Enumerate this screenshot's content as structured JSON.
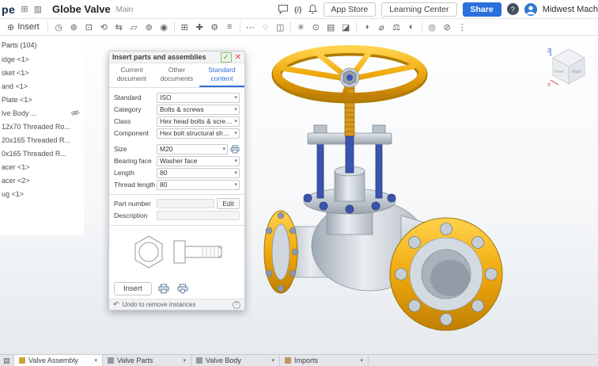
{
  "ui": {
    "caret_glyph": "▾",
    "check_glyph": "✓",
    "close_glyph": "✕",
    "undo_glyph": "↶",
    "help_glyph": "?",
    "insert_plus_glyph": "⊕",
    "grid_glyph": "⊞",
    "panel_glyph": "▥",
    "code_glyph": "{/}",
    "tab_manager_glyph": "▤"
  },
  "colors": {
    "accent_blue": "#2e6fd6",
    "share_blue": "#2a6fdb",
    "valve_gold": "#e8a80c",
    "valve_blue": "#3b55ae"
  },
  "header": {
    "logo_fragment": "pe",
    "title": "Globe Valve",
    "subtitle": "Main",
    "app_store": "App Store",
    "learning_center": "Learning Center",
    "share": "Share",
    "user_name": "Midwest Mach"
  },
  "toolbar": {
    "insert_label": "Insert",
    "icons": [
      {
        "name": "history-icon",
        "glyph": "◷"
      },
      {
        "name": "mate-icon",
        "glyph": "⊛"
      },
      {
        "name": "fastened-mate-icon",
        "glyph": "⊡"
      },
      {
        "name": "revolute-mate-icon",
        "glyph": "⟲"
      },
      {
        "name": "slider-mate-icon",
        "glyph": "⇆"
      },
      {
        "name": "planar-mate-icon",
        "glyph": "▱"
      },
      {
        "name": "cylindrical-mate-icon",
        "glyph": "⊚"
      },
      {
        "name": "ball-mate-icon",
        "glyph": "◉"
      },
      {
        "sep": true
      },
      {
        "name": "group-icon",
        "glyph": "⊞"
      },
      {
        "name": "mate-connector-icon",
        "glyph": "✚"
      },
      {
        "name": "gear-relation-icon",
        "glyph": "⚙"
      },
      {
        "name": "screw-relation-icon",
        "glyph": "≡"
      },
      {
        "sep": true
      },
      {
        "name": "linear-pattern-icon",
        "glyph": "⋯"
      },
      {
        "name": "circular-pattern-icon",
        "glyph": "◌"
      },
      {
        "name": "mirror-icon",
        "glyph": "◫"
      },
      {
        "sep": true
      },
      {
        "name": "explode-icon",
        "glyph": "✳"
      },
      {
        "name": "snapshot-icon",
        "glyph": "⊙"
      },
      {
        "name": "bom-icon",
        "glyph": "▤"
      },
      {
        "name": "named-positions-icon",
        "glyph": "◪"
      },
      {
        "sep": true
      },
      {
        "name": "section-view-icon",
        "glyph": "◑"
      },
      {
        "name": "measure-icon",
        "glyph": "⌀"
      },
      {
        "name": "mass-properties-icon",
        "glyph": "⚖"
      },
      {
        "name": "appearance-icon",
        "glyph": "◐"
      },
      {
        "sep": true
      },
      {
        "name": "display-options-icon",
        "glyph": "◎"
      },
      {
        "name": "hide-icon",
        "glyph": "⊘"
      },
      {
        "name": "more-icon",
        "glyph": "⋮"
      }
    ]
  },
  "parts_panel": {
    "header": "Parts (104)",
    "items": [
      {
        "label": "idge <1>"
      },
      {
        "label": "sket <1>"
      },
      {
        "label": "and <1>"
      },
      {
        "label": "Plate <1>"
      },
      {
        "label": "lve Body ...",
        "hidden": true
      },
      {
        "label": "12x70 Threaded Ro..."
      },
      {
        "label": "20x165 Threaded R..."
      },
      {
        "label": "0x165 Threaded R..."
      },
      {
        "label": "acer <1>"
      },
      {
        "label": "acer <2>"
      },
      {
        "label": "ug <1>"
      }
    ]
  },
  "dialog": {
    "title": "Insert parts and assemblies",
    "tabs": [
      {
        "name": "tab-current-document",
        "label": "Current document"
      },
      {
        "name": "tab-other-documents",
        "label": "Other documents"
      },
      {
        "name": "tab-standard-content",
        "label": "Standard content",
        "active": true
      }
    ],
    "fields": [
      {
        "name": "standard-select",
        "label": "Standard",
        "value": "ISO"
      },
      {
        "name": "category-select",
        "label": "Category",
        "value": "Bolts & screws"
      },
      {
        "name": "class-select",
        "label": "Class",
        "value": "Hex head bolts & screws"
      },
      {
        "name": "component-select",
        "label": "Component",
        "value": "Hex bolt structural short grade C ISC"
      },
      {
        "name": "size-select",
        "label": "Size",
        "value": "M20",
        "extra_icon": true,
        "group_start": true
      },
      {
        "name": "bearing-face-select",
        "label": "Bearing face",
        "value": "Washer face"
      },
      {
        "name": "length-select",
        "label": "Length",
        "value": "80"
      },
      {
        "name": "thread-length-select",
        "label": "Thread length",
        "value": "80"
      }
    ],
    "part_number_label": "Part number",
    "edit_button": "Edit",
    "description_label": "Description",
    "insert_button": "Insert",
    "footer_text": "Undo to remove instances"
  },
  "viewport": {
    "view_cube": {
      "z": "Z",
      "x": "X",
      "front": "Front",
      "right": "Right"
    }
  },
  "tabs_bar": {
    "tabs": [
      {
        "name": "tab-valve-assembly",
        "label": "Valve Assembly",
        "active": true,
        "icon_color": "#caa53d"
      },
      {
        "name": "tab-valve-parts",
        "label": "Valve Parts",
        "icon_color": "#8f9ba8"
      },
      {
        "name": "tab-valve-body",
        "label": "Valve Body",
        "icon_color": "#8f9ba8"
      },
      {
        "name": "tab-imports",
        "label": "Imports",
        "icon_color": "#b9995a"
      }
    ]
  }
}
